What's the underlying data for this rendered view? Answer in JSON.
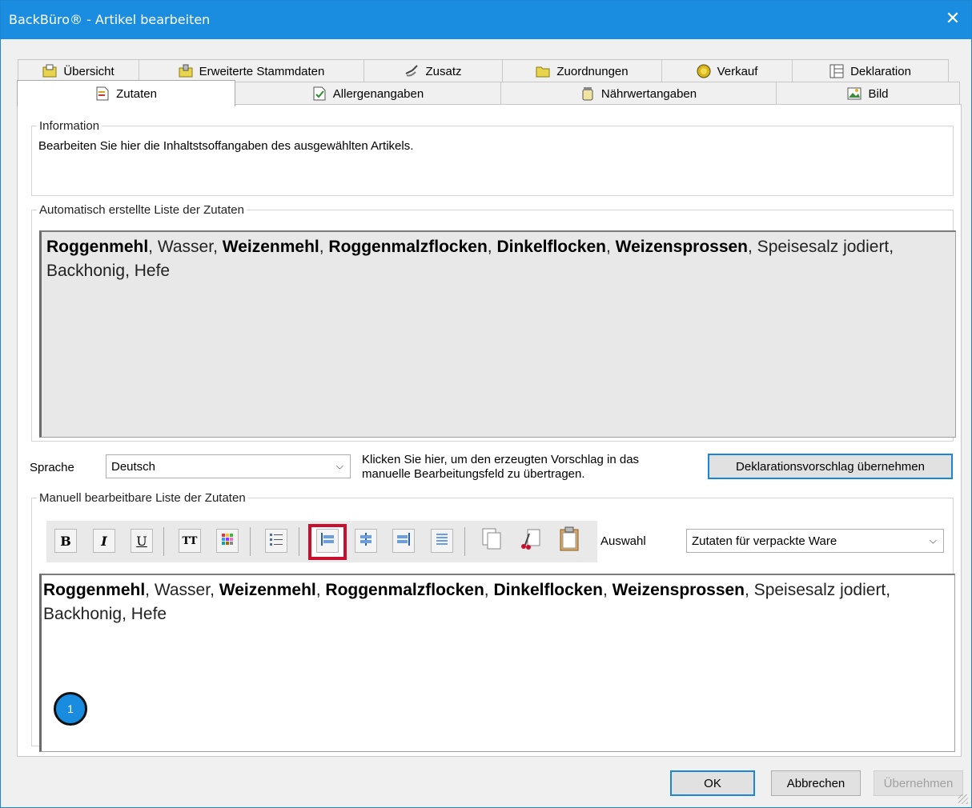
{
  "window": {
    "title": "BackBüro® - Artikel bearbeiten",
    "close_symbol": "✕"
  },
  "tabs_row1": [
    {
      "label": "Übersicht",
      "icon": "folder-doc-icon"
    },
    {
      "label": "Erweiterte Stammdaten",
      "icon": "folder-data-icon"
    },
    {
      "label": "Zusatz",
      "icon": "tools-icon"
    },
    {
      "label": "Zuordnungen",
      "icon": "folder-icon"
    },
    {
      "label": "Verkauf",
      "icon": "coin-icon"
    },
    {
      "label": "Deklaration",
      "icon": "table-icon"
    }
  ],
  "tabs_row2": [
    {
      "label": "Zutaten",
      "icon": "document-icon",
      "active": true
    },
    {
      "label": "Allergenangaben",
      "icon": "document-check-icon"
    },
    {
      "label": "Nährwertangaben",
      "icon": "jar-icon"
    },
    {
      "label": "Bild",
      "icon": "image-icon"
    }
  ],
  "information": {
    "legend": "Information",
    "text": "Bearbeiten Sie hier die Inhaltstsoffangaben des ausgewählten Artikels."
  },
  "auto_list": {
    "legend": "Automatisch erstellte Liste der Zutaten",
    "segments": [
      {
        "text": "Roggenmehl",
        "bold": true
      },
      {
        "text": ", Wasser, ",
        "bold": false
      },
      {
        "text": "Weizenmehl",
        "bold": true
      },
      {
        "text": ", ",
        "bold": false
      },
      {
        "text": "Roggenmalzflocken",
        "bold": true
      },
      {
        "text": ", ",
        "bold": false
      },
      {
        "text": "Dinkelflocken",
        "bold": true
      },
      {
        "text": ", ",
        "bold": false
      },
      {
        "text": "Weizensprossen",
        "bold": true
      },
      {
        "text": ", Speisesalz jodiert, Backhonig, Hefe",
        "bold": false
      }
    ]
  },
  "language": {
    "label": "Sprache",
    "value": "Deutsch",
    "hint_line1": "Klicken Sie hier, um den erzeugten Vorschlag in das",
    "hint_line2": "manuelle Bearbeitungsfeld zu übertragen.",
    "apply_button": "Deklarationsvorschlag übernehmen"
  },
  "manual_list": {
    "legend": "Manuell bearbeitbare Liste der Zutaten",
    "toolbar": {
      "bold": "B",
      "italic": "I",
      "underline": "U",
      "font_size": "TT",
      "selection_label": "Auswahl",
      "selection_value": "Zutaten für verpackte Ware"
    },
    "segments": [
      {
        "text": "Roggenmehl",
        "bold": true
      },
      {
        "text": ", Wasser, ",
        "bold": false
      },
      {
        "text": "Weizenmehl",
        "bold": true
      },
      {
        "text": ", ",
        "bold": false
      },
      {
        "text": "Roggenmalzflocken",
        "bold": true
      },
      {
        "text": ", ",
        "bold": false
      },
      {
        "text": "Dinkelflocken",
        "bold": true
      },
      {
        "text": ", ",
        "bold": false
      },
      {
        "text": "Weizensprossen",
        "bold": true
      },
      {
        "text": ", Speisesalz jodiert, Backhonig, Hefe",
        "bold": false
      }
    ]
  },
  "marker": "1",
  "buttons": {
    "ok": "OK",
    "cancel": "Abbrechen",
    "apply": "Übernehmen"
  },
  "colors": {
    "titlebar": "#1b8de0",
    "highlight": "#c8102e",
    "marker": "#1a8cdf"
  }
}
